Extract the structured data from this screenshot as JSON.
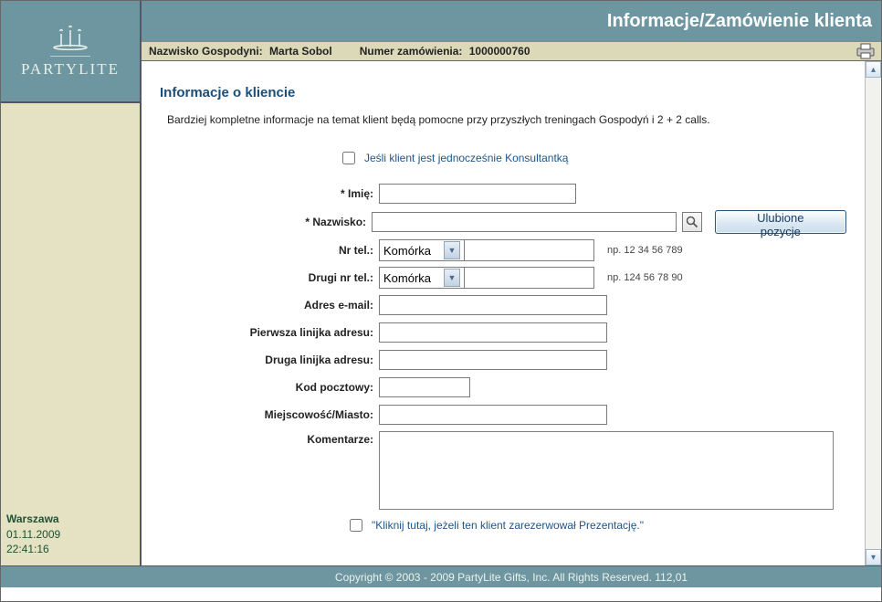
{
  "brand": "PARTYLITE",
  "sidebar": {
    "city": "Warszawa",
    "date": "01.11.2009",
    "time": "22:41:16"
  },
  "header": {
    "page_title": "Informacje/Zamówienie klienta"
  },
  "infobar": {
    "hostess_label": "Nazwisko Gospodyni:",
    "hostess_value": "Marta Sobol",
    "order_label": "Numer zamówienia:",
    "order_value": "1000000760"
  },
  "section": {
    "title": "Informacje o kliencie",
    "intro": "Bardziej kompletne informacje na temat klient będą pomocne przy przyszłych treningach Gospodyń i 2 + 2 calls."
  },
  "consultant_checkbox_label": "Jeśli klient jest jednocześnie Konsultantką",
  "labels": {
    "firstname": "* Imię:",
    "lastname": "* Nazwisko:",
    "phone": "Nr tel.:",
    "phone2": "Drugi nr tel.:",
    "email": "Adres e-mail:",
    "addr1": "Pierwsza linijka adresu:",
    "addr2": "Druga linijka adresu:",
    "postal": "Kod pocztowy:",
    "city": "Miejscowość/Miasto:",
    "comments": "Komentarze:"
  },
  "phone_type": "Komórka",
  "phone_hint1": "np. 12 34 56 789",
  "phone_hint2": "np. 124 56 78 90",
  "fav_button": "Ulubione pozycje",
  "reserve_label": "\"Kliknij tutaj, jeżeli ten klient zarezerwował Prezentację.\"",
  "footer": "Copyright © 2003 - 2009 PartyLite Gifts, Inc. All Rights Reserved.  112,01"
}
